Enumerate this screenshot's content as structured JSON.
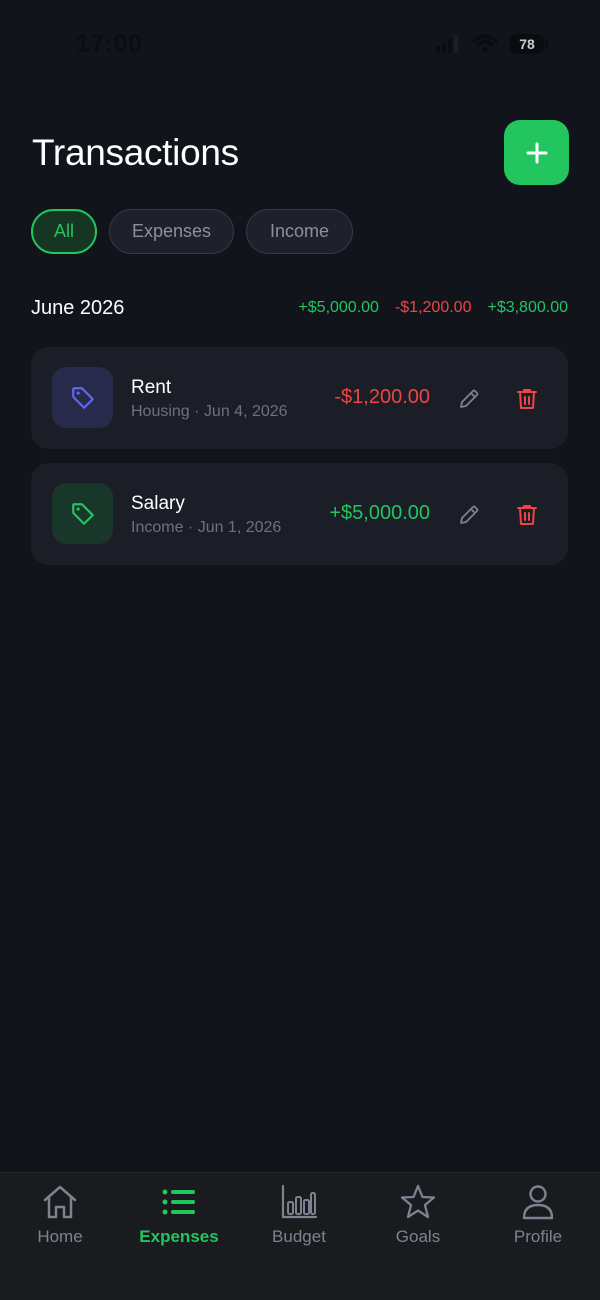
{
  "status_bar": {
    "time": "17:00",
    "battery": "78"
  },
  "header": {
    "title": "Transactions",
    "add_icon": "plus-icon"
  },
  "filters": [
    {
      "label": "All",
      "active": true
    },
    {
      "label": "Expenses",
      "active": false
    },
    {
      "label": "Income",
      "active": false
    }
  ],
  "summary": {
    "month": "June 2026",
    "income": "+$5,000.00",
    "expenses": "-$1,200.00",
    "net": "+$3,800.00"
  },
  "transactions": [
    {
      "title": "Rent",
      "subtitle": "Housing · Jun 4, 2026",
      "amount": "-$1,200.00",
      "icon": "tag-icon",
      "accent": "#6366f1"
    },
    {
      "title": "Salary",
      "subtitle": "Income · Jun 1, 2026",
      "amount": "+$5,000.00",
      "icon": "tag-icon",
      "accent": "#22c55e"
    }
  ],
  "tabs": [
    {
      "label": "Home",
      "icon": "home-icon",
      "active": false
    },
    {
      "label": "Expenses",
      "icon": "list-icon",
      "active": true
    },
    {
      "label": "Budget",
      "icon": "bar-chart-icon",
      "active": false
    },
    {
      "label": "Goals",
      "icon": "star-icon",
      "active": false
    },
    {
      "label": "Profile",
      "icon": "user-icon",
      "active": false
    }
  ],
  "colors": {
    "accent": "#22c55e",
    "negative": "#ef4444",
    "background": "#12141b",
    "card": "#1b1e27"
  }
}
